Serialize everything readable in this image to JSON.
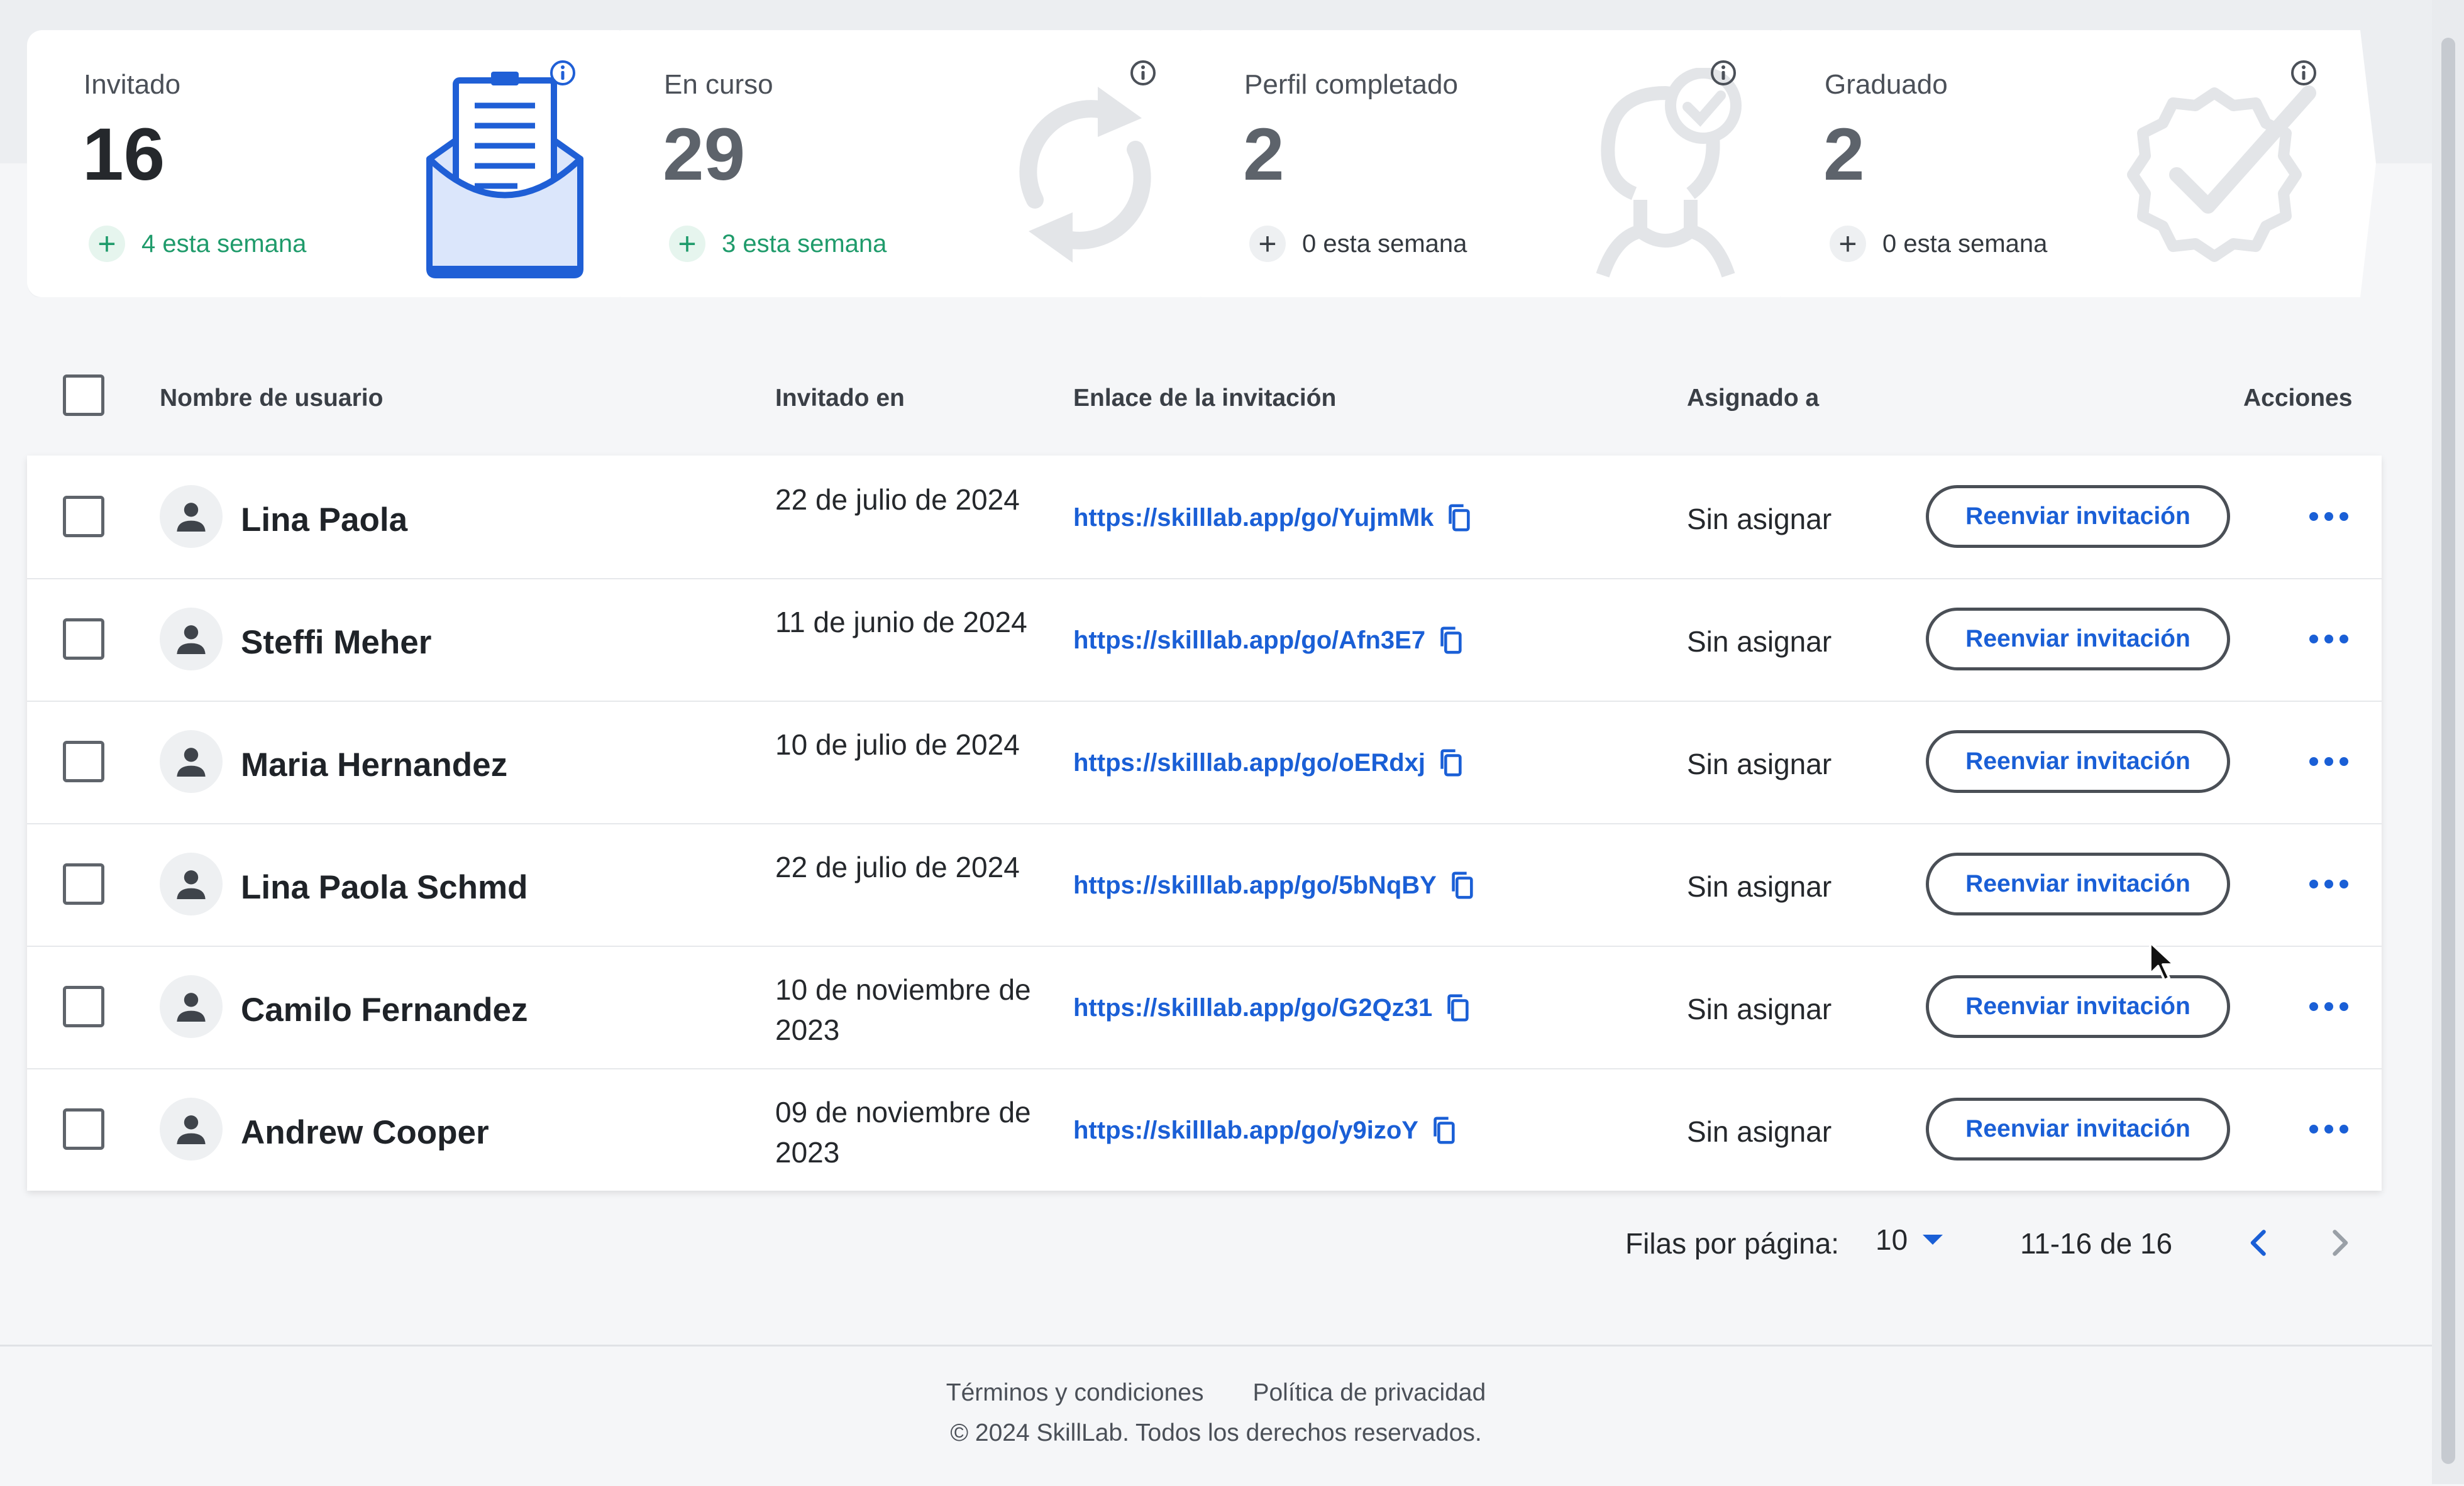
{
  "stats": [
    {
      "label": "Invitado",
      "value": "16",
      "week": "4 esta semana"
    },
    {
      "label": "En curso",
      "value": "29",
      "week": "3 esta semana"
    },
    {
      "label": "Perfil completado",
      "value": "2",
      "week": "0 esta semana"
    },
    {
      "label": "Graduado",
      "value": "2",
      "week": "0 esta semana"
    }
  ],
  "table": {
    "headers": {
      "username": "Nombre de usuario",
      "invited_on": "Invitado en",
      "invite_link": "Enlace de la invitación",
      "assigned_to": "Asignado a",
      "actions": "Acciones"
    },
    "resend_label": "Reenviar invitación",
    "rows": [
      {
        "name": "Lina Paola",
        "invited_on": "22 de julio de 2024",
        "link": "https://skilllab.app/go/YujmMk",
        "assigned": "Sin asignar"
      },
      {
        "name": "Steffi Meher",
        "invited_on": "11 de junio de 2024",
        "link": "https://skilllab.app/go/Afn3E7",
        "assigned": "Sin asignar"
      },
      {
        "name": "Maria Hernandez",
        "invited_on": "10 de julio de 2024",
        "link": "https://skilllab.app/go/oERdxj",
        "assigned": "Sin asignar"
      },
      {
        "name": "Lina Paola Schmd",
        "invited_on": "22 de julio de 2024",
        "link": "https://skilllab.app/go/5bNqBY",
        "assigned": "Sin asignar"
      },
      {
        "name": "Camilo Fernandez",
        "invited_on": "10 de noviembre de 2023",
        "link": "https://skilllab.app/go/G2Qz31",
        "assigned": "Sin asignar"
      },
      {
        "name": "Andrew Cooper",
        "invited_on": "09 de noviembre de 2023",
        "link": "https://skilllab.app/go/y9izoY",
        "assigned": "Sin asignar"
      }
    ]
  },
  "pagination": {
    "rows_per_page_label": "Filas por página:",
    "rows_per_page_value": "10",
    "range": "11-16 de 16"
  },
  "footer": {
    "terms": "Términos y condiciones",
    "privacy": "Política de privacidad",
    "copyright": "© 2024 SkillLab. Todos los derechos reservados."
  },
  "colors": {
    "accent": "#1a5fd6",
    "positive": "#1f9b6b",
    "card_bg": "#ffffff",
    "page_bg": "#f5f6f8"
  },
  "icons": [
    "info-icon",
    "envelope-letter-icon",
    "refresh-cycle-icon",
    "user-check-icon",
    "badge-check-icon",
    "plus-icon",
    "person-icon",
    "copy-icon",
    "more-horizontal-icon",
    "chevron-left-icon",
    "chevron-right-icon",
    "caret-down-icon"
  ]
}
